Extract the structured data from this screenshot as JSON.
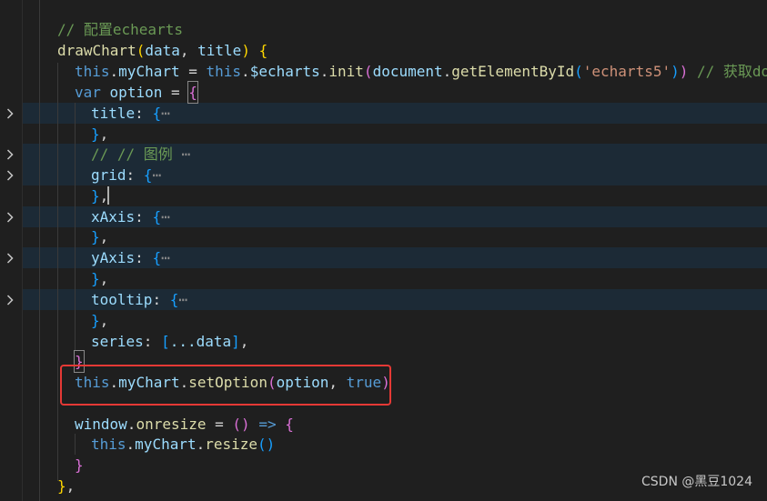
{
  "editor": {
    "comment_config": "// 配置echearts",
    "method_name": "drawChart",
    "param_data": "data",
    "param_title": "title",
    "kw_this": "this",
    "prop_myChart": "myChart",
    "prop_echarts": "$echarts",
    "fn_init": "init",
    "obj_document": "document",
    "fn_getElementById": "getElementById",
    "str_id": "'echarts5'",
    "comment_dom": "// 获取dom",
    "kw_var": "var",
    "var_option": "option",
    "key_title": "title",
    "comment_legend": "// // 图例",
    "key_grid": "grid",
    "key_xAxis": "xAxis",
    "key_yAxis": "yAxis",
    "key_tooltip": "tooltip",
    "key_series": "series",
    "spread_data": "...data",
    "fn_setOption": "setOption",
    "kw_true": "true",
    "obj_window": "window",
    "prop_onresize": "onresize",
    "fn_resize": "resize",
    "fold_ellipsis": "⋯"
  },
  "watermark": "CSDN @黑豆1024",
  "colors": {
    "background": "#1f1f1f",
    "folded_line_bg": "#1c2a36",
    "highlight_box": "#e53935",
    "comment": "#6a9955",
    "function": "#dcdcaa",
    "variable": "#9cdcfe",
    "keyword": "#569cd6",
    "string": "#ce9178"
  }
}
